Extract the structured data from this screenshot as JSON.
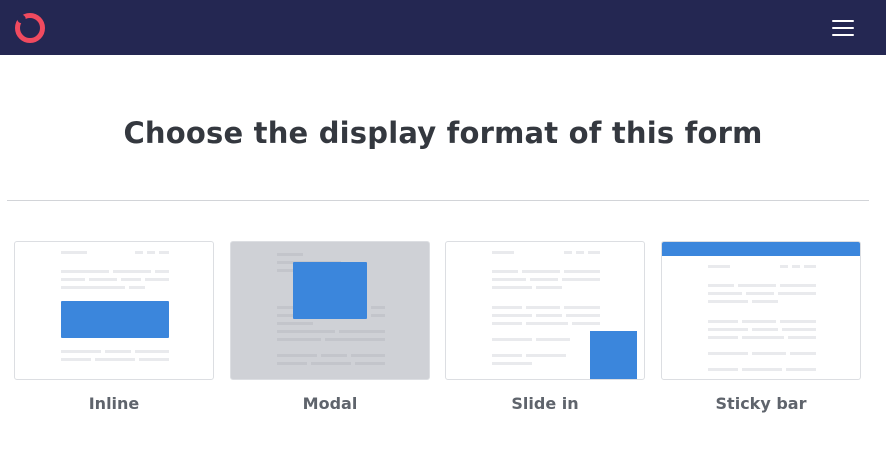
{
  "header": {
    "logo_icon": "brand-ring-logo",
    "menu_icon": "hamburger-menu-icon",
    "background": "#242752",
    "accent": "#f04a5f"
  },
  "main": {
    "title": "Choose the display format of this form"
  },
  "formats": [
    {
      "id": "inline",
      "label": "Inline"
    },
    {
      "id": "modal",
      "label": "Modal"
    },
    {
      "id": "slide-in",
      "label": "Slide in"
    },
    {
      "id": "sticky-bar",
      "label": "Sticky bar"
    }
  ],
  "colors": {
    "form_blue": "#3b86dc",
    "placeholder_line": "#e9eaed",
    "modal_overlay": "#cfd1d6"
  }
}
